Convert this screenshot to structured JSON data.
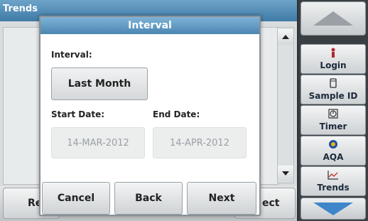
{
  "background": {
    "title": "Trends",
    "bottom_left_label": "Re",
    "bottom_right_label": "ect"
  },
  "sidebar": {
    "items": [
      {
        "label": "Login",
        "icon": "person-icon"
      },
      {
        "label": "Sample ID",
        "icon": "beaker-icon"
      },
      {
        "label": "Timer",
        "icon": "clock-icon"
      },
      {
        "label": "AQA",
        "icon": "aqa-icon"
      },
      {
        "label": "Trends",
        "icon": "trend-chart-icon"
      }
    ]
  },
  "modal": {
    "title": "Interval",
    "interval_label": "Interval:",
    "interval_value": "Last Month",
    "start_date_label": "Start Date:",
    "end_date_label": "End Date:",
    "start_date": "14-MAR-2012",
    "end_date": "14-APR-2012",
    "cancel_label": "Cancel",
    "back_label": "Back",
    "next_label": "Next"
  },
  "colors": {
    "title_bar": "#4a86b2",
    "disabled_text": "#9aa0a4",
    "scroll_arrow_blue": "#3e86c9"
  }
}
